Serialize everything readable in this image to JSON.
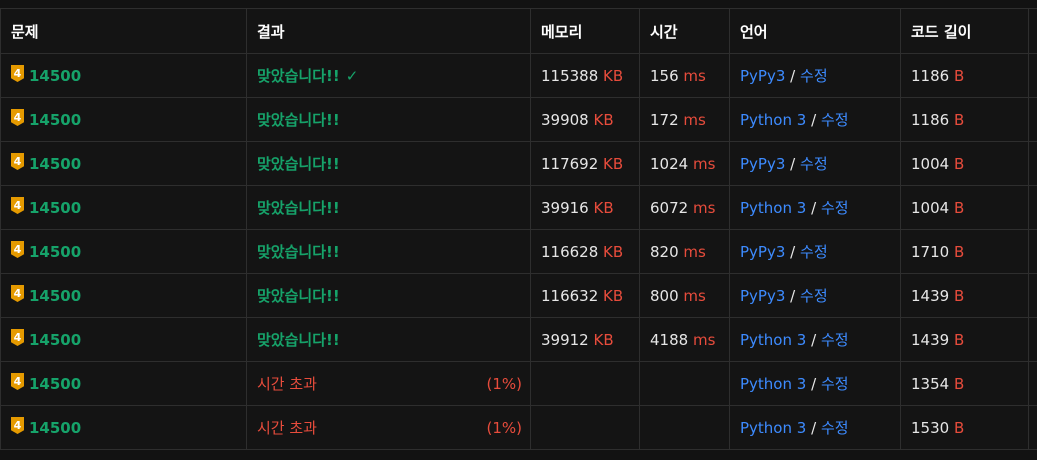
{
  "headers": {
    "problem": "문제",
    "result": "결과",
    "memory": "메모리",
    "time": "시간",
    "language": "언어",
    "code_length": "코드 길이"
  },
  "units": {
    "memory": "KB",
    "time": "ms",
    "length": "B"
  },
  "edit_label": "수정",
  "separator": "/",
  "rows": [
    {
      "tier": "4",
      "problem": "14500",
      "result": "맞았습니다!!",
      "check": "✓",
      "percent": "",
      "memory": "115388",
      "time": "156",
      "language": "PyPy3",
      "length": "1186"
    },
    {
      "tier": "4",
      "problem": "14500",
      "result": "맞았습니다!!",
      "check": "",
      "percent": "",
      "memory": "39908",
      "time": "172",
      "language": "Python 3",
      "length": "1186"
    },
    {
      "tier": "4",
      "problem": "14500",
      "result": "맞았습니다!!",
      "check": "",
      "percent": "",
      "memory": "117692",
      "time": "1024",
      "language": "PyPy3",
      "length": "1004"
    },
    {
      "tier": "4",
      "problem": "14500",
      "result": "맞았습니다!!",
      "check": "",
      "percent": "",
      "memory": "39916",
      "time": "6072",
      "language": "Python 3",
      "length": "1004"
    },
    {
      "tier": "4",
      "problem": "14500",
      "result": "맞았습니다!!",
      "check": "",
      "percent": "",
      "memory": "116628",
      "time": "820",
      "language": "PyPy3",
      "length": "1710"
    },
    {
      "tier": "4",
      "problem": "14500",
      "result": "맞았습니다!!",
      "check": "",
      "percent": "",
      "memory": "116632",
      "time": "800",
      "language": "PyPy3",
      "length": "1439"
    },
    {
      "tier": "4",
      "problem": "14500",
      "result": "맞았습니다!!",
      "check": "",
      "percent": "",
      "memory": "39912",
      "time": "4188",
      "language": "Python 3",
      "length": "1439"
    },
    {
      "tier": "4",
      "problem": "14500",
      "result": "시간 초과",
      "check": "",
      "percent": "(1%)",
      "memory": "",
      "time": "",
      "language": "Python 3",
      "length": "1354"
    },
    {
      "tier": "4",
      "problem": "14500",
      "result": "시간 초과",
      "check": "",
      "percent": "(1%)",
      "memory": "",
      "time": "",
      "language": "Python 3",
      "length": "1530"
    }
  ],
  "colors": {
    "accepted": "#16a36a",
    "time_limit": "#e74c3c",
    "link": "#3d8bff",
    "tier_badge": "#e59a00",
    "background": "#141414"
  }
}
